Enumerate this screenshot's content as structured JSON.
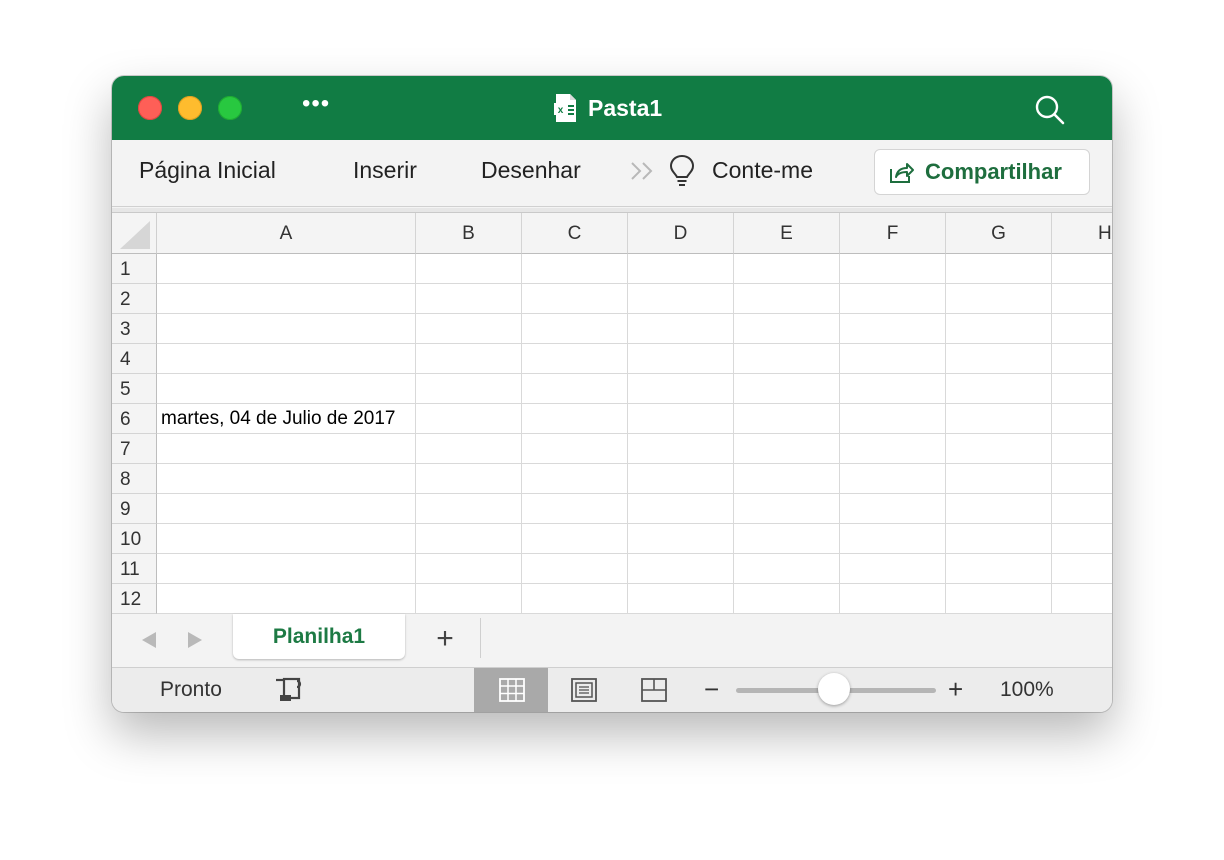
{
  "window": {
    "title": "Pasta1",
    "accent_color": "#117c44",
    "controls": [
      "close",
      "minimize",
      "zoom"
    ],
    "more_icon": "ellipsis-icon",
    "doc_icon": "excel-document-icon",
    "search_icon": "search-icon"
  },
  "ribbon": {
    "tabs": [
      {
        "label": "Página Inicial"
      },
      {
        "label": "Inserir"
      },
      {
        "label": "Desenhar"
      }
    ],
    "overflow_icon": "double-chevron-right-icon",
    "tell_me": {
      "icon": "lightbulb-icon",
      "label": "Conte-me"
    },
    "share": {
      "icon": "share-icon",
      "label": "Compartilhar"
    }
  },
  "sheet": {
    "columns": [
      "A",
      "B",
      "C",
      "D",
      "E",
      "F",
      "G",
      "H"
    ],
    "rows": [
      "1",
      "2",
      "3",
      "4",
      "5",
      "6",
      "7",
      "8",
      "9",
      "10",
      "11",
      "12"
    ],
    "cells": {
      "A6": "martes, 04 de Julio de 2017"
    }
  },
  "tabs": {
    "prev_icon": "triangle-left-icon",
    "next_icon": "triangle-right-icon",
    "sheets": [
      {
        "label": "Planilha1",
        "active": true
      }
    ],
    "add_label": "+"
  },
  "status": {
    "text": "Pronto",
    "macro_icon": "macro-record-icon",
    "views": [
      {
        "name": "normal-view",
        "active": true
      },
      {
        "name": "page-layout-view",
        "active": false
      },
      {
        "name": "page-break-view",
        "active": false
      }
    ],
    "zoom_minus": "−",
    "zoom_plus": "+",
    "zoom_level": 100,
    "zoom_label": "100%"
  }
}
